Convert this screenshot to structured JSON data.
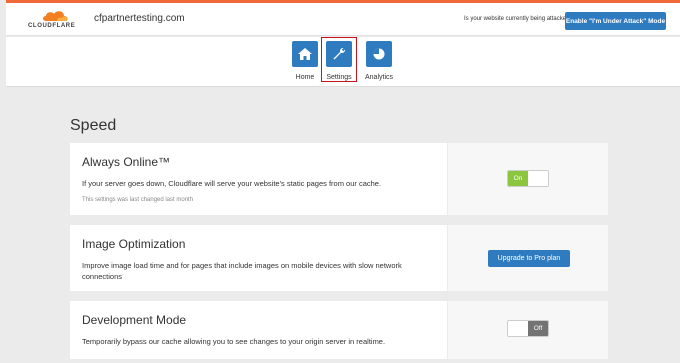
{
  "header": {
    "logo_text": "CLOUDFLARE",
    "domain": "cfpartnertesting.com",
    "attack_question": "Is your website currently being attacked?",
    "attack_button": "Enable \"I'm Under Attack\" Mode"
  },
  "nav": {
    "items": [
      {
        "label": "Home",
        "icon": "home-icon"
      },
      {
        "label": "Settings",
        "icon": "wrench-icon",
        "selected": true
      },
      {
        "label": "Analytics",
        "icon": "pie-chart-icon"
      }
    ]
  },
  "section": {
    "title": "Speed"
  },
  "cards": [
    {
      "title": "Always Online™",
      "description": "If your server goes down, Cloudflare will serve your website's static pages from our cache.",
      "meta": "This settings was last changed last month",
      "toggle": {
        "state": "on",
        "label": "On"
      }
    },
    {
      "title": "Image Optimization",
      "description": "Improve image load time and for pages that include images on mobile devices with slow network connections",
      "button": "Upgrade to Pro plan"
    },
    {
      "title": "Development Mode",
      "description": "Temporarily bypass our cache allowing you to see changes to your origin server in realtime.",
      "toggle": {
        "state": "off",
        "label": "Off"
      }
    }
  ],
  "colors": {
    "accent": "#2f7bbf",
    "brand_orange": "#f0693b",
    "toggle_on": "#8cc63e",
    "toggle_off": "#737373",
    "selected_outline": "#c4161c"
  }
}
